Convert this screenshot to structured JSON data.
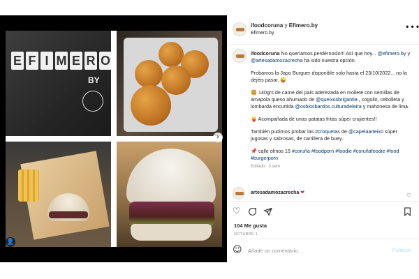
{
  "post": {
    "header": {
      "author": "ifoodcoruna",
      "conjunction": "y",
      "coauthor": "Efimero.by",
      "subtitle": "Efimero.by",
      "more_icon": "more-horizontal-icon",
      "more_label": "•••"
    },
    "media": {
      "brand_letters": [
        "E",
        "F",
        "I",
        "M",
        "E",
        "R",
        "O"
      ],
      "brand_suffix": "BY",
      "next_label": "›",
      "tag_label": "👤"
    },
    "caption": {
      "author": "ifoodcoruna",
      "line1": "No queríamos perdérnoslo!!! Así que hoy...",
      "mention1": "@efimero.by",
      "amp": " y ",
      "mention2": "@artesadamozacrecha",
      "line1_end": " ha sido nuestra opción.",
      "p2": "Probamos la Japo Burguer disponible solo hasta el 23/10/2022... no la dejéis pasar. 😜",
      "p3_start": "🍔 140grs de carne del país aderezada en mollete con semillas de amapola queso ahumado de ",
      "p3_mention1": "@queixosbrigantia",
      "p3_mid": " , cogollo, cebolleta y lombarda encurtida ",
      "p3_mention2": "@osbiosbardos.culturadeleira",
      "p3_end": " y mahonesa de lima.",
      "p4": "🍟 Acompañada de unas patatas fritas súper crujientes!!",
      "p5_start": "También pudimos probar las ",
      "p5_tag": "#croquetas",
      "p5_mid": " de ",
      "p5_mention": "@capelaarteixo",
      "p5_end": " súper jugosas y sabrosas, de carrillera de buey.",
      "p6_start": "📌 calle olmos 15 ",
      "hashtags": "#coruña #foodporn #foodie #coruñafoodie #food #burgerporn",
      "edited": "Editado · 3 sem"
    },
    "comment": {
      "author": "artesadamozacrecha",
      "heart": "❤",
      "like_icon": "heart-outline-icon",
      "like_label": "♡"
    },
    "actions": {
      "like_label": "♡",
      "comment_label": "💬",
      "share_label": "✈",
      "save_label": "🔖",
      "likes": "104 Me gusta",
      "date": "OCTUBRE 1"
    },
    "add_comment": {
      "emoji_label": "☺",
      "placeholder": "Añade un comentario...",
      "publish_label": "Publicar"
    }
  }
}
